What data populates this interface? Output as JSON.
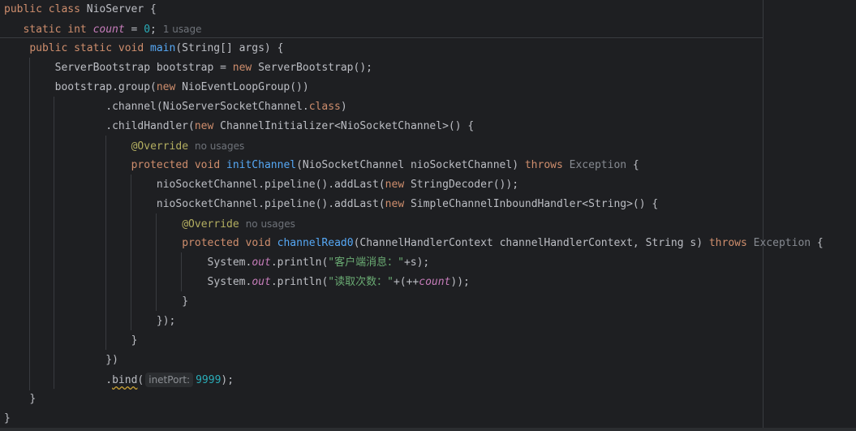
{
  "colors": {
    "background": "#1e1f22",
    "keyword": "#cf8e6d",
    "function": "#56a8f5",
    "number": "#2aacb8",
    "string": "#6aab73",
    "annotation": "#b3ae60",
    "static_field": "#c77dbb",
    "text": "#bcbec4"
  },
  "code_lines": [
    {
      "indent": 0,
      "tokens": [
        {
          "t": "public class ",
          "c": "kw"
        },
        {
          "t": "NioServer {"
        }
      ]
    },
    {
      "indent": 3,
      "tokens": [
        {
          "t": "static int ",
          "c": "kw"
        },
        {
          "t": "count",
          "c": "fld"
        },
        {
          "t": " = "
        },
        {
          "t": "0",
          "c": "num"
        },
        {
          "t": ";"
        },
        {
          "t": "1 usage",
          "c": "hint"
        }
      ]
    },
    {
      "indent": 4,
      "tokens": [
        {
          "t": "public static void ",
          "c": "kw"
        },
        {
          "t": "main",
          "c": "fn"
        },
        {
          "t": "(String[] args) {"
        }
      ]
    },
    {
      "indent": 8,
      "tokens": [
        {
          "t": "ServerBootstrap bootstrap = "
        },
        {
          "t": "new ",
          "c": "kw"
        },
        {
          "t": "ServerBootstrap();"
        }
      ]
    },
    {
      "indent": 8,
      "tokens": [
        {
          "t": "bootstrap.group("
        },
        {
          "t": "new ",
          "c": "kw"
        },
        {
          "t": "NioEventLoopGroup())"
        }
      ]
    },
    {
      "indent": 16,
      "tokens": [
        {
          "t": ".channel(NioServerSocketChannel."
        },
        {
          "t": "class",
          "c": "kw"
        },
        {
          "t": ")"
        }
      ]
    },
    {
      "indent": 16,
      "tokens": [
        {
          "t": ".childHandler("
        },
        {
          "t": "new ",
          "c": "kw"
        },
        {
          "t": "ChannelInitializer<NioSocketChannel>() {"
        }
      ]
    },
    {
      "indent": 20,
      "tokens": [
        {
          "t": "@Override",
          "c": "ann"
        },
        {
          "t": "no usages",
          "c": "hint"
        }
      ]
    },
    {
      "indent": 20,
      "tokens": [
        {
          "t": "protected void ",
          "c": "kw"
        },
        {
          "t": "initChannel",
          "c": "fn"
        },
        {
          "t": "(NioSocketChannel nioSocketChannel) "
        },
        {
          "t": "throws ",
          "c": "kw"
        },
        {
          "t": "Exception",
          "c": "unres"
        },
        {
          "t": " {"
        }
      ]
    },
    {
      "indent": 24,
      "tokens": [
        {
          "t": "nioSocketChannel.pipeline().addLast("
        },
        {
          "t": "new ",
          "c": "kw"
        },
        {
          "t": "StringDecoder());"
        }
      ]
    },
    {
      "indent": 24,
      "tokens": [
        {
          "t": "nioSocketChannel.pipeline().addLast("
        },
        {
          "t": "new ",
          "c": "kw"
        },
        {
          "t": "SimpleChannelInboundHandler<String>() {"
        }
      ]
    },
    {
      "indent": 28,
      "tokens": [
        {
          "t": "@Override",
          "c": "ann"
        },
        {
          "t": "no usages",
          "c": "hint"
        }
      ]
    },
    {
      "indent": 28,
      "tokens": [
        {
          "t": "protected void ",
          "c": "kw"
        },
        {
          "t": "channelRead0",
          "c": "fn"
        },
        {
          "t": "(ChannelHandlerContext channelHandlerContext, String s) "
        },
        {
          "t": "throws ",
          "c": "kw"
        },
        {
          "t": "Exception",
          "c": "unres"
        },
        {
          "t": " {"
        }
      ]
    },
    {
      "indent": 32,
      "tokens": [
        {
          "t": "System."
        },
        {
          "t": "out",
          "c": "fld"
        },
        {
          "t": ".println("
        },
        {
          "t": "\"客户端消息：\"",
          "c": "str"
        },
        {
          "t": "+s);"
        }
      ]
    },
    {
      "indent": 32,
      "tokens": [
        {
          "t": "System."
        },
        {
          "t": "out",
          "c": "fld"
        },
        {
          "t": ".println("
        },
        {
          "t": "\"读取次数：\"",
          "c": "str"
        },
        {
          "t": "+(++"
        },
        {
          "t": "count",
          "c": "fld"
        },
        {
          "t": "));"
        }
      ]
    },
    {
      "indent": 28,
      "tokens": [
        {
          "t": "}"
        }
      ]
    },
    {
      "indent": 24,
      "tokens": [
        {
          "t": "});"
        }
      ]
    },
    {
      "indent": 20,
      "tokens": [
        {
          "t": "}"
        }
      ]
    },
    {
      "indent": 16,
      "tokens": [
        {
          "t": "})"
        }
      ]
    },
    {
      "indent": 16,
      "tokens": [
        {
          "t": "."
        },
        {
          "t": "bind",
          "c": "warn"
        },
        {
          "t": "("
        },
        {
          "t": "inetPort:",
          "c": "pill"
        },
        {
          "t": "9999",
          "c": "num"
        },
        {
          "t": ");"
        }
      ]
    },
    {
      "indent": 4,
      "tokens": [
        {
          "t": "}"
        }
      ]
    },
    {
      "indent": 0,
      "tokens": [
        {
          "t": "}"
        }
      ]
    }
  ]
}
